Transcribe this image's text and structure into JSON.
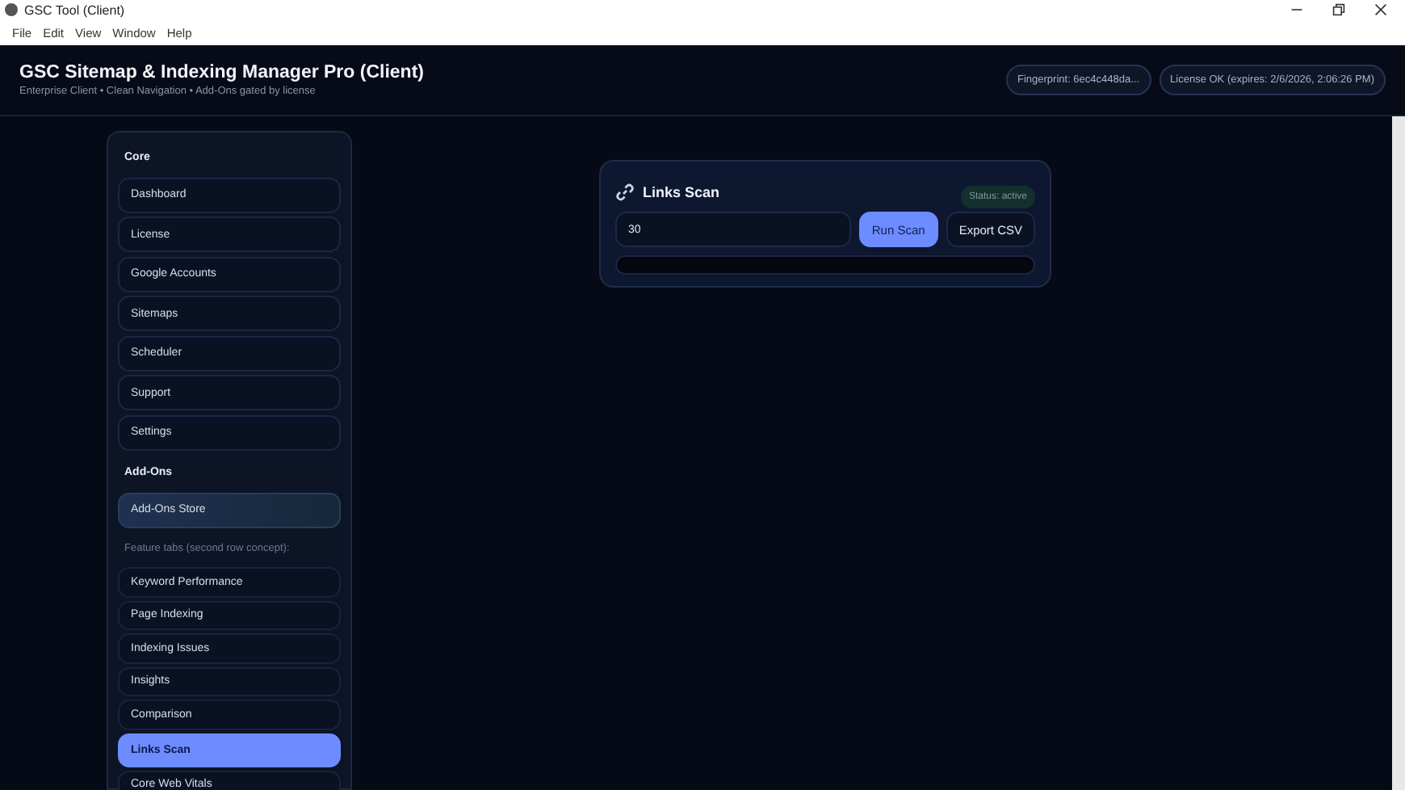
{
  "window": {
    "title": "GSC Tool (Client)"
  },
  "menu": [
    "File",
    "Edit",
    "View",
    "Window",
    "Help"
  ],
  "header": {
    "title": "GSC Sitemap & Indexing Manager Pro (Client)",
    "subtitle": "Enterprise Client • Clean Navigation • Add-Ons gated by license",
    "badges": [
      "Fingerprint: 6ec4c448da...",
      "License OK (expires: 2/6/2026, 2:06:26 PM)"
    ]
  },
  "sidebar": {
    "sections": [
      {
        "title": "Core",
        "items": [
          {
            "label": "Dashboard",
            "selected": false
          },
          {
            "label": "License",
            "selected": false
          },
          {
            "label": "Google Accounts",
            "selected": false
          },
          {
            "label": "Sitemaps",
            "selected": false
          },
          {
            "label": "Scheduler",
            "selected": false
          },
          {
            "label": "Support",
            "selected": false
          },
          {
            "label": "Settings",
            "selected": false
          }
        ]
      },
      {
        "title": "Add-Ons",
        "items": [
          {
            "label": "Add-Ons Store",
            "selected": false,
            "kind": "store"
          }
        ],
        "note": "Feature tabs (second row concept):",
        "tabs": [
          {
            "label": "Keyword Performance",
            "selected": false
          },
          {
            "label": "Page Indexing",
            "selected": false
          },
          {
            "label": "Indexing Issues",
            "selected": false
          },
          {
            "label": "Insights",
            "selected": false
          },
          {
            "label": "Comparison",
            "selected": false
          },
          {
            "label": "Links Scan",
            "selected": true
          },
          {
            "label": "Core Web Vitals",
            "selected": false
          }
        ]
      }
    ]
  },
  "panel": {
    "title": "Links Scan",
    "status": "Status: active",
    "input": {
      "value": "30"
    },
    "buttons": [
      {
        "label": "Run Scan",
        "kind": "primary"
      },
      {
        "label": "Export CSV",
        "kind": "secondary"
      }
    ]
  }
}
